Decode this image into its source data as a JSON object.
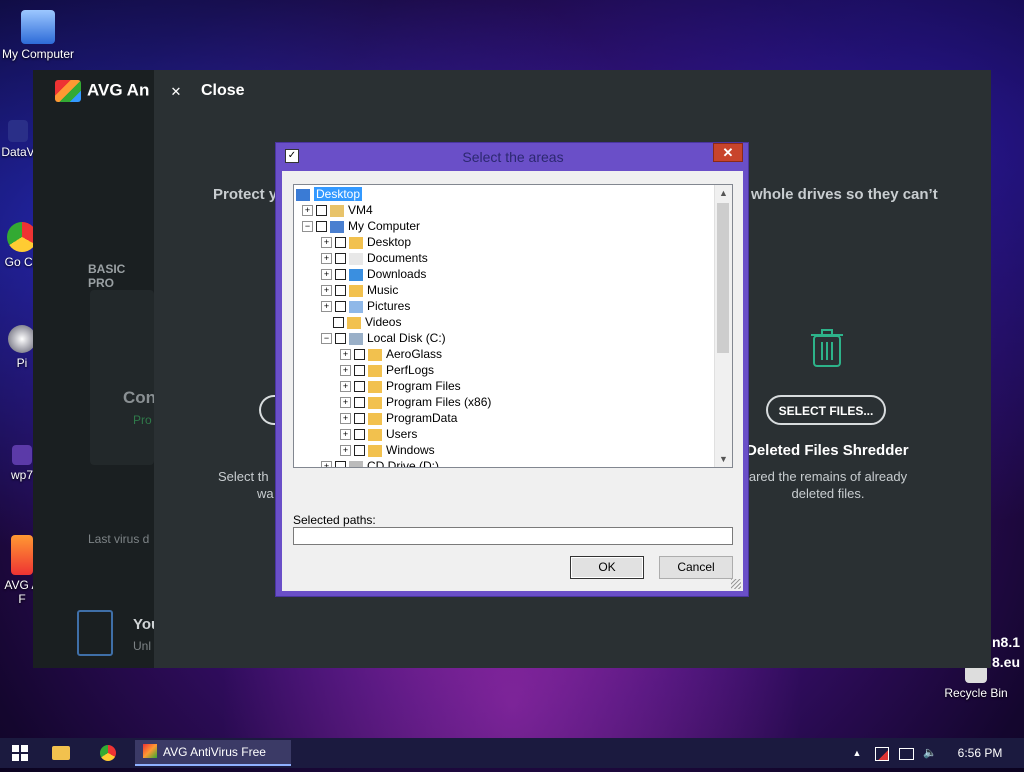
{
  "desktop": {
    "icons": [
      {
        "label": "My Computer"
      },
      {
        "label": "DataV"
      },
      {
        "label": "Go Ch"
      },
      {
        "label": "Pi"
      },
      {
        "label": "wp7"
      },
      {
        "label": "AVG A F"
      },
      {
        "label": "Recycle Bin"
      }
    ],
    "watermark": [
      "n8.1",
      "8.eu"
    ]
  },
  "avg": {
    "logo": "AVG An",
    "side_heading": "BASIC PRO",
    "side_item_title": "Con",
    "side_item_sub": "Pro",
    "side_select_text": [
      "Select th",
      "wa"
    ],
    "last_virus": "Last virus d",
    "promo_title": "You",
    "promo_sub": "Unl",
    "close_label": "Close",
    "protect_text_left": "Protect y",
    "protect_text_right": "whole drives so they can’t",
    "select_files_label": "SELECT FILES...",
    "shredder_title": "Deleted Files Shredder",
    "shredder_desc": "ared the remains of already deleted files."
  },
  "dialog": {
    "title": "Select the areas",
    "close_glyph": "✕",
    "tree": [
      {
        "label": "Desktop",
        "level": 0,
        "expander": "",
        "checkbox": false,
        "selected": true,
        "icon": "desktop-icon"
      },
      {
        "label": "VM4",
        "level": 1,
        "expander": "+",
        "checkbox": true,
        "icon": "user-folder-icon"
      },
      {
        "label": "My Computer",
        "level": 1,
        "expander": "−",
        "checkbox": true,
        "icon": "computer-icon"
      },
      {
        "label": "Desktop",
        "level": 2,
        "expander": "+",
        "checkbox": true,
        "icon": "folder-icon"
      },
      {
        "label": "Documents",
        "level": 2,
        "expander": "+",
        "checkbox": true,
        "icon": "documents-icon"
      },
      {
        "label": "Downloads",
        "level": 2,
        "expander": "+",
        "checkbox": true,
        "icon": "downloads-icon"
      },
      {
        "label": "Music",
        "level": 2,
        "expander": "+",
        "checkbox": true,
        "icon": "music-icon"
      },
      {
        "label": "Pictures",
        "level": 2,
        "expander": "+",
        "checkbox": true,
        "icon": "pictures-icon"
      },
      {
        "label": "Videos",
        "level": 2,
        "expander": "",
        "checkbox": true,
        "icon": "videos-icon"
      },
      {
        "label": "Local Disk (C:)",
        "level": 2,
        "expander": "−",
        "checkbox": true,
        "icon": "drive-icon"
      },
      {
        "label": "AeroGlass",
        "level": 3,
        "expander": "+",
        "checkbox": true,
        "icon": "folder-icon"
      },
      {
        "label": "PerfLogs",
        "level": 3,
        "expander": "+",
        "checkbox": true,
        "icon": "folder-icon"
      },
      {
        "label": "Program Files",
        "level": 3,
        "expander": "+",
        "checkbox": true,
        "icon": "folder-icon"
      },
      {
        "label": "Program Files (x86)",
        "level": 3,
        "expander": "+",
        "checkbox": true,
        "icon": "folder-icon"
      },
      {
        "label": "ProgramData",
        "level": 3,
        "expander": "+",
        "checkbox": true,
        "icon": "folder-icon"
      },
      {
        "label": "Users",
        "level": 3,
        "expander": "+",
        "checkbox": true,
        "icon": "folder-icon"
      },
      {
        "label": "Windows",
        "level": 3,
        "expander": "+",
        "checkbox": true,
        "icon": "folder-icon"
      },
      {
        "label": "CD Drive (D:)",
        "level": 2,
        "expander": "+",
        "checkbox": true,
        "icon": "cd-drive-icon"
      }
    ],
    "selected_paths_label": "Selected paths:",
    "selected_paths_value": "",
    "ok_label": "OK",
    "cancel_label": "Cancel"
  },
  "taskbar": {
    "app_label": "AVG AntiVirus Free",
    "clock": "6:56 PM",
    "tray_up_glyph": "▲"
  },
  "colors": {
    "dialog_frame": "#6a4fc8",
    "dialog_close": "#c8442c",
    "avg_bg": "#1f2426",
    "taskbar": "#1b1a3f",
    "tree_selection": "#3399ff"
  }
}
